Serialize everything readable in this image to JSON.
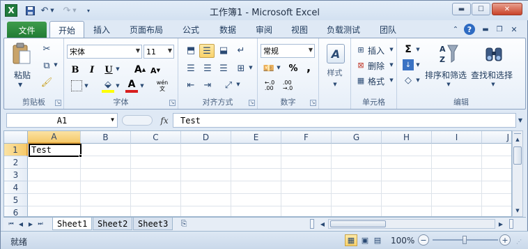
{
  "window": {
    "title": "工作簿1 - Microsoft Excel",
    "app_icon": "X"
  },
  "tabs": {
    "file": "文件",
    "home": "开始",
    "insert": "插入",
    "page_layout": "页面布局",
    "formulas": "公式",
    "data": "数据",
    "review": "审阅",
    "view": "视图",
    "load_test": "负载测试",
    "team": "团队"
  },
  "ribbon": {
    "clipboard": {
      "paste": "粘贴",
      "label": "剪贴板"
    },
    "font": {
      "name": "宋体",
      "size": "11",
      "label": "字体",
      "bold": "B",
      "italic": "I",
      "underline": "U",
      "grow": "A",
      "shrink": "A",
      "wen": "wén\n文"
    },
    "alignment": {
      "label": "对齐方式"
    },
    "number": {
      "format": "常规",
      "label": "数字",
      "percent": "%",
      "comma": ","
    },
    "styles": {
      "label": "样式"
    },
    "cells": {
      "insert": "插入",
      "delete": "删除",
      "format": "格式",
      "label": "单元格"
    },
    "editing": {
      "sort_filter": "排序和筛选",
      "find_select": "查找和选择",
      "label": "编辑"
    }
  },
  "formula_bar": {
    "name_box": "A1",
    "fx": "fx",
    "value": "Test"
  },
  "grid": {
    "columns": [
      "A",
      "B",
      "C",
      "D",
      "E",
      "F",
      "G",
      "H",
      "I",
      "J"
    ],
    "rows": [
      "1",
      "2",
      "3",
      "4",
      "5",
      "6"
    ],
    "a1": "Test"
  },
  "sheets": [
    "Sheet1",
    "Sheet2",
    "Sheet3"
  ],
  "status": {
    "mode": "就绪",
    "zoom": "100%"
  }
}
